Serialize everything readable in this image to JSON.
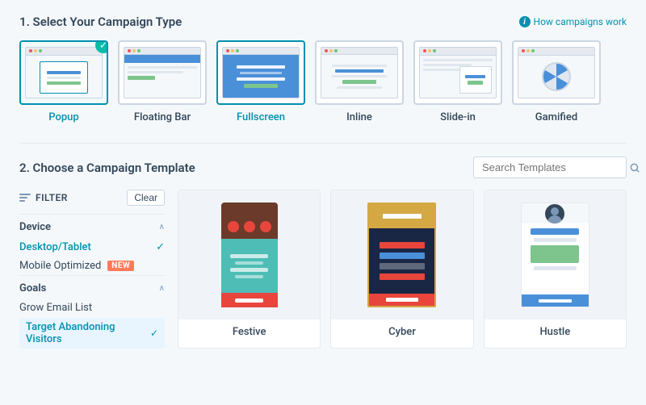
{
  "section1": {
    "title": "1. Select Your Campaign Type",
    "how_link": "How campaigns work",
    "campaign_types": [
      {
        "id": "popup",
        "label": "Popup",
        "selected": true
      },
      {
        "id": "floating-bar",
        "label": "Floating Bar",
        "selected": false
      },
      {
        "id": "fullscreen",
        "label": "Fullscreen",
        "selected": false,
        "active": true
      },
      {
        "id": "inline",
        "label": "Inline",
        "selected": false
      },
      {
        "id": "slide-in",
        "label": "Slide-in",
        "selected": false
      },
      {
        "id": "gamified",
        "label": "Gamified",
        "selected": false
      }
    ]
  },
  "section2": {
    "title": "2. Choose a Campaign Template",
    "search": {
      "placeholder": "Search Templates"
    }
  },
  "filter": {
    "label": "FILTER",
    "clear_button": "Clear",
    "device": {
      "title": "Device",
      "options": [
        {
          "label": "Desktop/Tablet",
          "selected": true
        },
        {
          "label": "Mobile Optimized",
          "badge": "NEW"
        }
      ]
    },
    "goals": {
      "title": "Goals",
      "items": [
        {
          "label": "Grow Email List",
          "selected": false
        },
        {
          "label": "Target Abandoning Visitors",
          "selected": true
        }
      ]
    }
  },
  "templates": [
    {
      "id": "festive",
      "name": "Festive"
    },
    {
      "id": "cyber",
      "name": "Cyber"
    },
    {
      "id": "hustle",
      "name": "Hustle"
    }
  ],
  "icons": {
    "info": "i",
    "check": "✓",
    "chevron_up": "∧",
    "search": "🔍",
    "filter": "≡"
  }
}
